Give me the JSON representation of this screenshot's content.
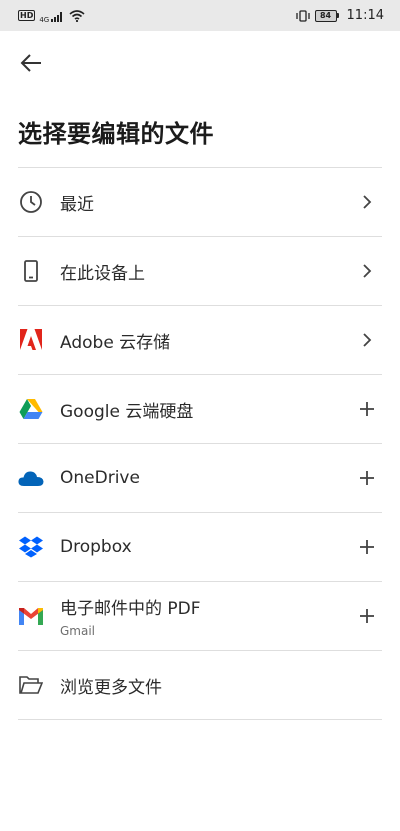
{
  "status_bar": {
    "hd": "HD",
    "network": "4G",
    "battery": "84",
    "time": "11:14"
  },
  "page": {
    "title": "选择要编辑的文件"
  },
  "items": [
    {
      "label": "最近",
      "icon": "clock-icon",
      "action": "chevron"
    },
    {
      "label": "在此设备上",
      "icon": "phone-icon",
      "action": "chevron"
    },
    {
      "label": "Adobe 云存储",
      "icon": "adobe-icon",
      "action": "chevron"
    },
    {
      "label": "Google 云端硬盘",
      "icon": "google-drive-icon",
      "action": "plus"
    },
    {
      "label": "OneDrive",
      "icon": "onedrive-icon",
      "action": "plus"
    },
    {
      "label": "Dropbox",
      "icon": "dropbox-icon",
      "action": "plus"
    },
    {
      "label": "电子邮件中的 PDF",
      "sublabel": "Gmail",
      "icon": "gmail-icon",
      "action": "plus"
    },
    {
      "label": "浏览更多文件",
      "icon": "folder-icon",
      "action": "none"
    }
  ],
  "colors": {
    "adobe_red": "#e1251b",
    "onedrive_blue": "#0364b8",
    "dropbox_blue": "#0061fe",
    "divider": "#dedede"
  }
}
